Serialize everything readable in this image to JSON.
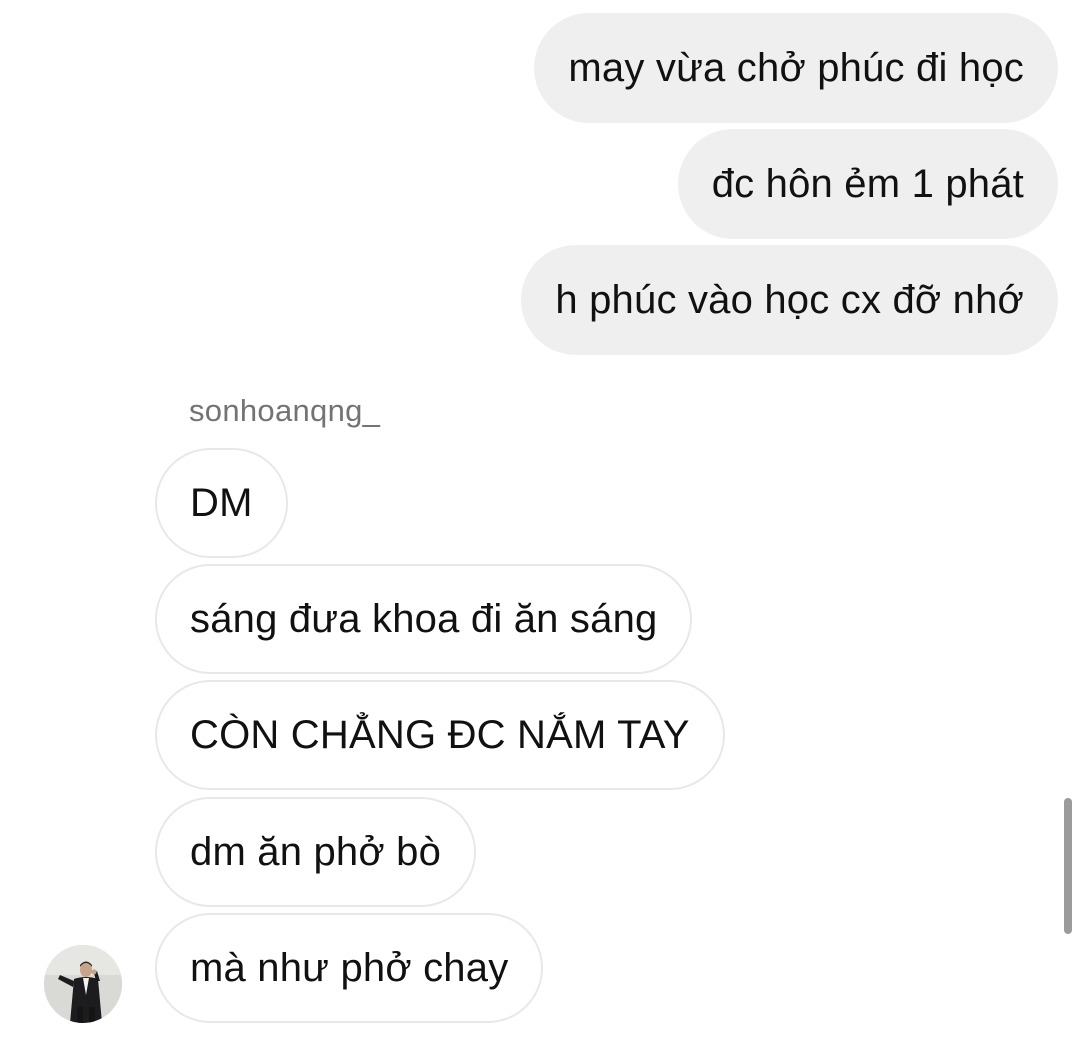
{
  "thread": {
    "outgoing_messages": [
      "may vừa chở phúc đi học",
      "đc hôn ẻm 1 phát",
      "h phúc vào học cx đỡ nhớ"
    ],
    "sender_username": "sonhoanqng_",
    "incoming_messages": [
      "DM",
      "sáng đưa khoa đi ăn sáng",
      "CÒN CHẲNG ĐC NẮM TAY",
      "dm ăn phở bò",
      "mà như phở chay"
    ]
  },
  "colors": {
    "outgoing_bubble": "#efefef",
    "incoming_bubble_border": "#e8e8e8",
    "username_text": "#737373",
    "message_text": "#111111",
    "scrollbar": "#9b9b9b"
  },
  "icons": {
    "avatar": "profile-photo-man-in-suit"
  }
}
